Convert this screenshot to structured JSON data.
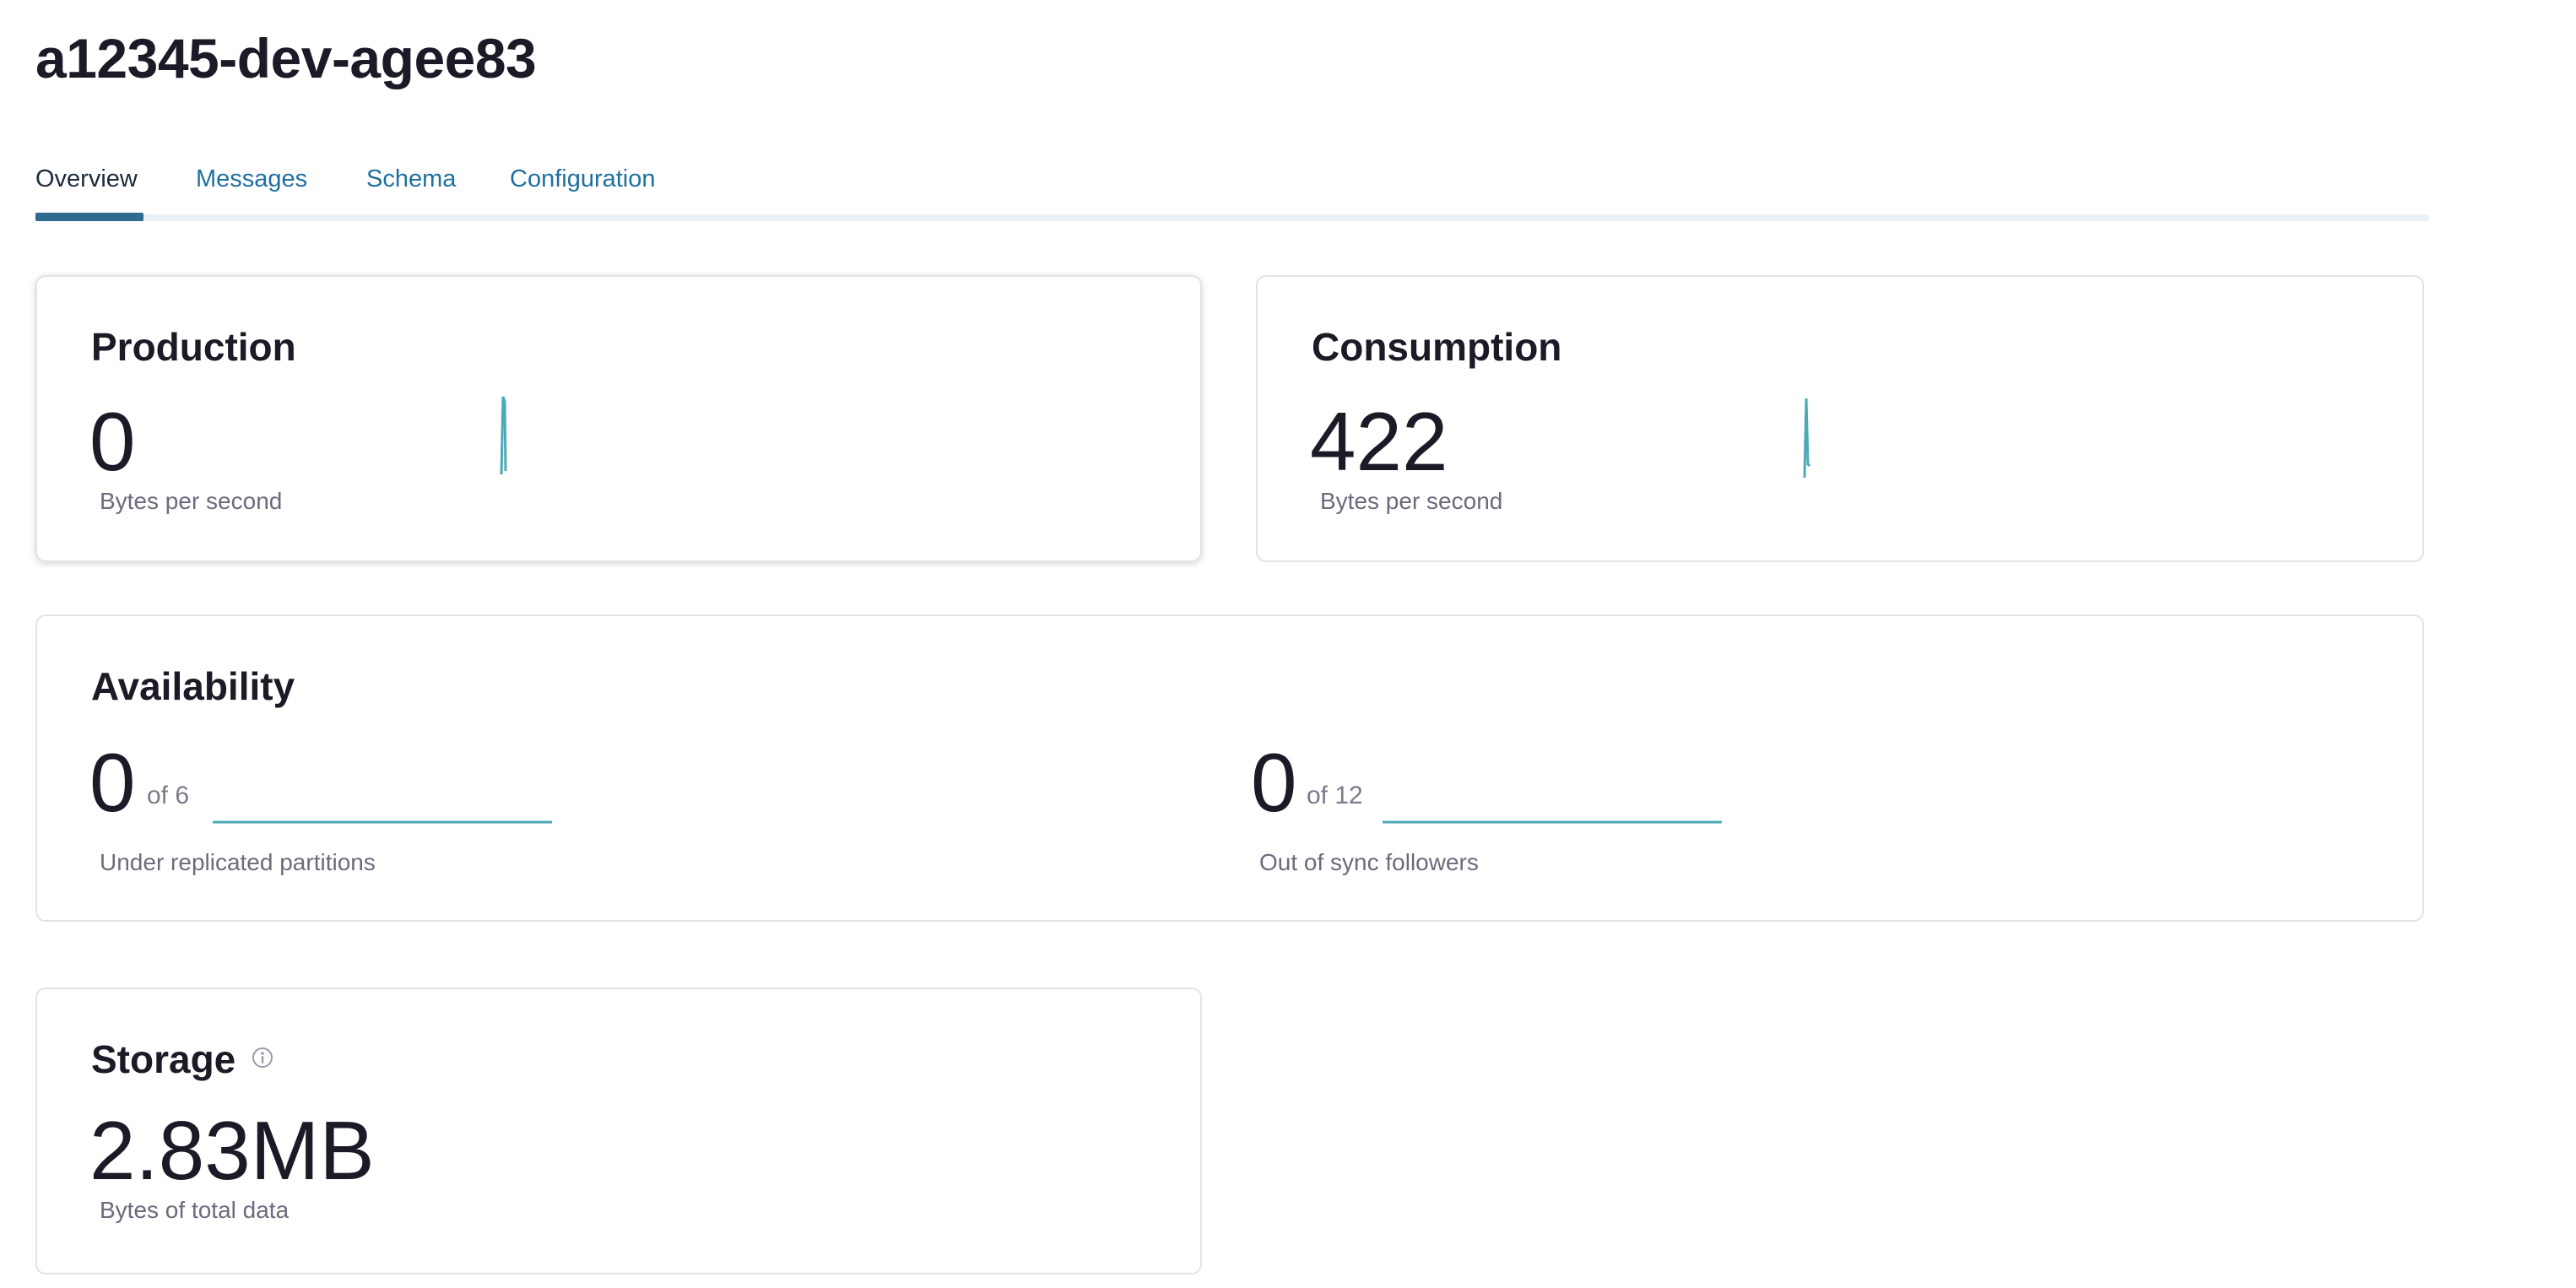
{
  "page": {
    "title": "a12345-dev-agee83"
  },
  "tabs": [
    {
      "label": "Overview",
      "active": true
    },
    {
      "label": "Messages",
      "active": false
    },
    {
      "label": "Schema",
      "active": false
    },
    {
      "label": "Configuration",
      "active": false
    }
  ],
  "colors": {
    "accent": "#2e6b8f",
    "tab_link": "#1f6f9f",
    "sparkline": "#4ba9b8"
  },
  "production": {
    "title": "Production",
    "value": "0",
    "label": "Bytes per second"
  },
  "consumption": {
    "title": "Consumption",
    "value": "422",
    "label": "Bytes per second"
  },
  "availability": {
    "title": "Availability",
    "under_replicated": {
      "value": "0",
      "of": "of 6",
      "label": "Under replicated partitions"
    },
    "out_of_sync": {
      "value": "0",
      "of": "of 12",
      "label": "Out of sync followers"
    }
  },
  "storage": {
    "title": "Storage",
    "info_icon": "info-icon",
    "value": "2.83MB",
    "label": "Bytes of total data"
  }
}
